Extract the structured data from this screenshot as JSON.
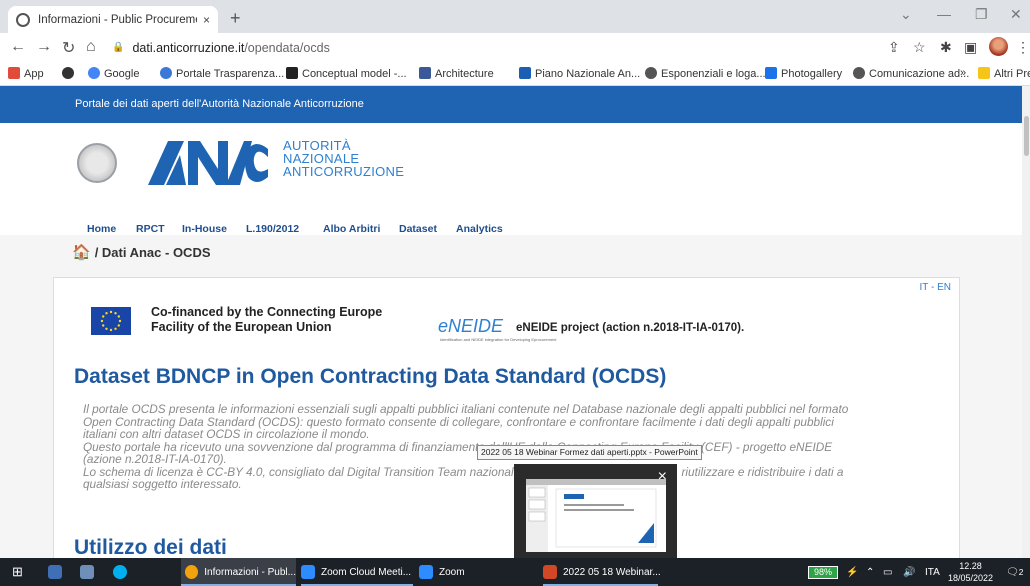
{
  "browser": {
    "tab_title": "Informazioni - Public Procureme",
    "tab_close": "×",
    "new_tab": "+",
    "url_host": "dati.anticorruzione.it",
    "url_path": "/opendata/ocds",
    "bookmarks": [
      {
        "label": "App",
        "color": "#e04b3a"
      },
      {
        "label": "",
        "color": "#333333"
      },
      {
        "label": "Google",
        "color": "#4285f4"
      },
      {
        "label": "Portale Trasparenza...",
        "color": "#3b78d8"
      },
      {
        "label": "Conceptual model -...",
        "color": "#222222"
      },
      {
        "label": "Architecture",
        "color": "#3b5998"
      },
      {
        "label": "Piano Nazionale An...",
        "color": "#1a5fb4"
      },
      {
        "label": "Esponenziali e loga...",
        "color": "#555555"
      },
      {
        "label": "Photogallery",
        "color": "#1a73e8"
      },
      {
        "label": "Comunicazione ad...",
        "color": "#555555"
      }
    ],
    "more_bookmarks": "»",
    "other_bookmarks": "Altri Preferiti"
  },
  "site": {
    "topbar": "Portale dei dati aperti dell'Autorità Nazionale Anticorruzione",
    "logo_word": "ANAC",
    "logo_lines": [
      "AUTORITÀ",
      "NAZIONALE",
      "ANTICORRUZIONE"
    ],
    "menu": [
      "Home",
      "RPCT",
      "In-House",
      "L.190/2012",
      "Albo Arbitri",
      "Dataset",
      "Analytics"
    ],
    "breadcrumb": "/ Dati Anac - OCDS"
  },
  "content": {
    "lang": "IT - EN",
    "eu_line1": "Co-financed by the Connecting Europe",
    "eu_line2": "Facility of the European Union",
    "eneide_logo": "eNEIDE",
    "eneide_sub": "Identification and NEIDE integration for Developing Eprocurement",
    "eneide_project": "eNEIDE project (action n.2018-IT-IA-0170).",
    "heading": "Dataset BDNCP in Open Contracting Data Standard (OCDS)",
    "para": [
      "Il portale OCDS presenta le informazioni essenziali sugli appalti pubblici italiani contenute nel Database nazionale degli appalti pubblici nel formato",
      "Open Contracting Data Standard (OCDS): questo formato consente di collegare, confrontare e confrontare facilmente i dati degli appalti pubblici",
      "italiani con altri dataset OCDS in circolazione il mondo.",
      "Questo portale ha ricevuto una sovvenzione dal programma di finanziamento dell'UE della Connecting Europe Facility (CEF) - progetto eNEIDE",
      "(azione n.2018-IT-IA-0170).",
      "Lo schema di licenza è CC-BY 4.0, consigliato dal Digital Transition Team nazionale che rende possibile utilizzare, riutilizzare e ridistribuire i dati a",
      "qualsiasi soggetto interessato."
    ],
    "heading2": "Utilizzo dei dati"
  },
  "overlay": {
    "tooltip": "2022 05 18 Webinar Formez dati aperti.pptx - PowerPoint",
    "close": "×"
  },
  "taskbar": {
    "items": [
      {
        "label": "Informazioni - Publ...",
        "color": "#f2a20c"
      },
      {
        "label": "Zoom Cloud Meeti...",
        "color": "#2d8cff"
      },
      {
        "label": "Zoom",
        "color": "#2d8cff"
      },
      {
        "label": "2022 05 18 Webinar...",
        "color": "#d24726"
      }
    ],
    "battery": "98%",
    "lang": "ITA",
    "time": "12.28",
    "date": "18/05/2022",
    "notifications": "2"
  }
}
